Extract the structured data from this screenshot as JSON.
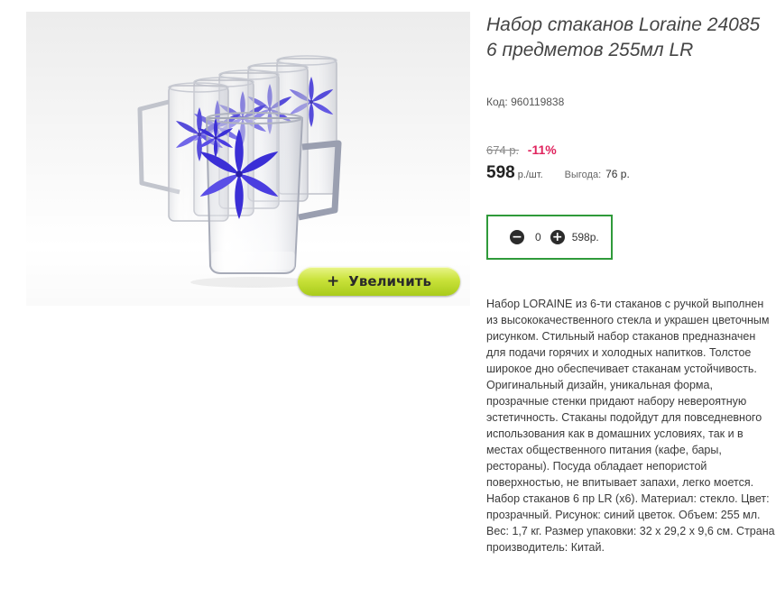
{
  "product": {
    "title": "Набор стаканов Loraine 24085 6 предметов 255мл LR",
    "code_label": "Код:",
    "code_value": "960119838",
    "old_price": "674 р.",
    "discount": "-11%",
    "price": "598",
    "price_unit": "р./шт.",
    "saving_label": "Выгода:",
    "saving_value": "76 р.",
    "description": "Набор LORAINE из 6-ти стаканов с ручкой выполнен из высококачественного стекла и украшен цветочным рисунком. Стильный набор стаканов предназначен для подачи горячих и холодных напитков. Толстое широкое дно обеспечивает стаканам устойчивость. Оригинальный дизайн, уникальная форма, прозрачные стенки придают набору невероятную эстетичность. Стаканы подойдут для повседневного использования как в домашних условиях, так и в местах общественного питания (кафе, бары, рестораны). Посуда обладает непористой поверхностью, не впитывает запахи, легко моется. Набор стаканов 6 пр LR (x6). Материал: стекло. Цвет: прозрачный. Рисунок: синий цветок. Объем: 255 мл. Вес: 1,7 кг. Размер упаковки: 32 х 29,2 х 9,6 см. Страна производитель: Китай."
  },
  "gallery": {
    "zoom_icon": "+",
    "zoom_label": "Увеличить"
  },
  "cart": {
    "minus_icon": "−",
    "quantity": "0",
    "plus_icon": "+",
    "total": "598р."
  },
  "colors": {
    "accent_green": "#2f9a3a",
    "discount_red": "#e0245e",
    "zoom_button": "#c9e23a",
    "flower_blue": "#3a2fd0"
  }
}
